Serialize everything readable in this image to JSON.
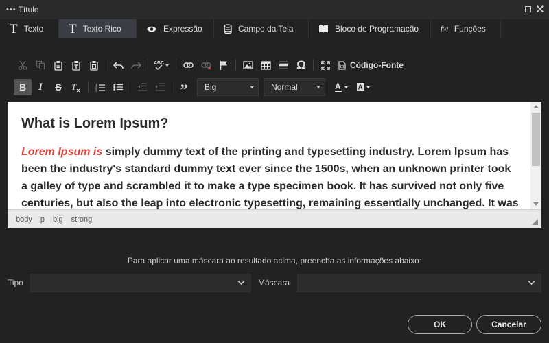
{
  "window": {
    "dots": "•••",
    "title": "Título"
  },
  "tabs": [
    {
      "label": "Texto",
      "icon": "text-t-icon"
    },
    {
      "label": "Texto Rico",
      "icon": "text-t-icon",
      "active": true
    },
    {
      "label": "Expressão",
      "icon": "eye-icon"
    },
    {
      "label": "Campo da Tela",
      "icon": "database-icon"
    },
    {
      "label": "Bloco de Programação",
      "icon": "book-icon"
    },
    {
      "label": "Funções",
      "icon": "function-icon"
    }
  ],
  "toolbar": {
    "code_label": "Código-Fonte",
    "style_value": "Big",
    "format_value": "Normal"
  },
  "editor": {
    "heading": "What is Lorem Ipsum?",
    "lead": "Lorem Ipsum is",
    "body": " simply dummy text of the printing and typesetting industry. Lorem Ipsum has been the industry's standard dummy text ever since the 1500s, when an unknown printer took a galley of type and scrambled it to make a type specimen book. It has survived not only five centuries, but also the leap into electronic typesetting, remaining essentially unchanged. It was"
  },
  "path": [
    "body",
    "p",
    "big",
    "strong"
  ],
  "mask": {
    "info": "Para aplicar uma máscara ao resultado acima, preencha as informações abaixo:",
    "tipo_label": "Tipo",
    "tipo_value": "",
    "mascara_label": "Máscara",
    "mascara_value": ""
  },
  "buttons": {
    "ok": "OK",
    "cancel": "Cancelar"
  },
  "colors": {
    "background": "#222222",
    "active_tab": "#3a3d44",
    "lead_text": "#d9413b"
  }
}
